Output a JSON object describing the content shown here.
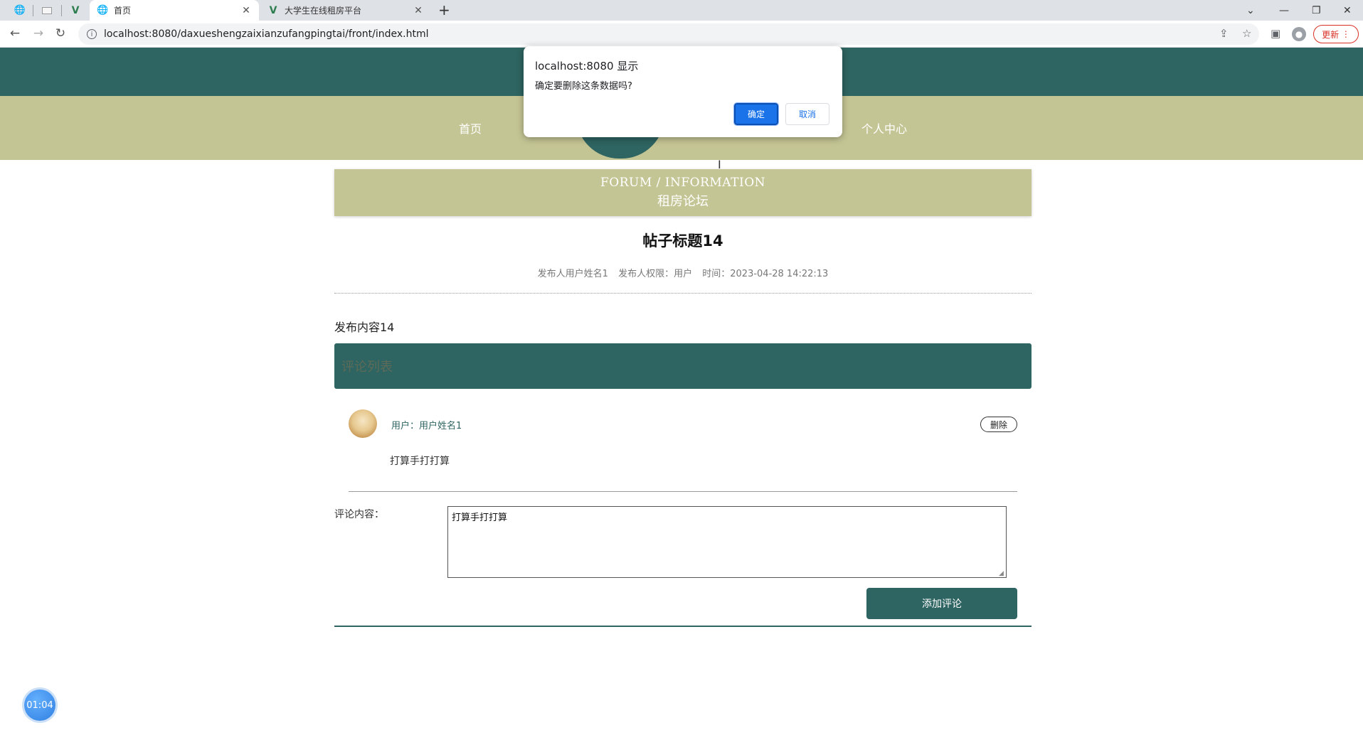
{
  "browser": {
    "tabs": [
      {
        "title": "首页"
      },
      {
        "title": "大学生在线租房平台"
      }
    ],
    "url": "localhost:8080/daxueshengzaixianzufangpingtai/front/index.html",
    "update_label": "更新"
  },
  "nav": {
    "items": [
      {
        "label": "首页"
      },
      {
        "label": "个人中心"
      }
    ]
  },
  "banner": {
    "english": "FORUM / INFORMATION",
    "chinese": "租房论坛"
  },
  "post": {
    "title": "帖子标题14",
    "author": "发布人用户姓名1",
    "role": "发布人权限：用户",
    "time": "时间：2023-04-28 14:22:13",
    "content": "发布内容14"
  },
  "comments": {
    "header": "评论列表",
    "items": [
      {
        "user": "用户：用户姓名1",
        "text": "打算手打打算",
        "delete_label": "删除"
      }
    ]
  },
  "form": {
    "label": "评论内容：",
    "value": "打算手打打算",
    "submit_label": "添加评论"
  },
  "timer": {
    "value": "01:04"
  },
  "dialog": {
    "title": "localhost:8080 显示",
    "message": "确定要删除这条数据吗?",
    "ok_label": "确定",
    "cancel_label": "取消"
  },
  "colors": {
    "primary": "#2e6461",
    "secondary": "#c4c594",
    "dialog_button": "#1a73e8"
  }
}
